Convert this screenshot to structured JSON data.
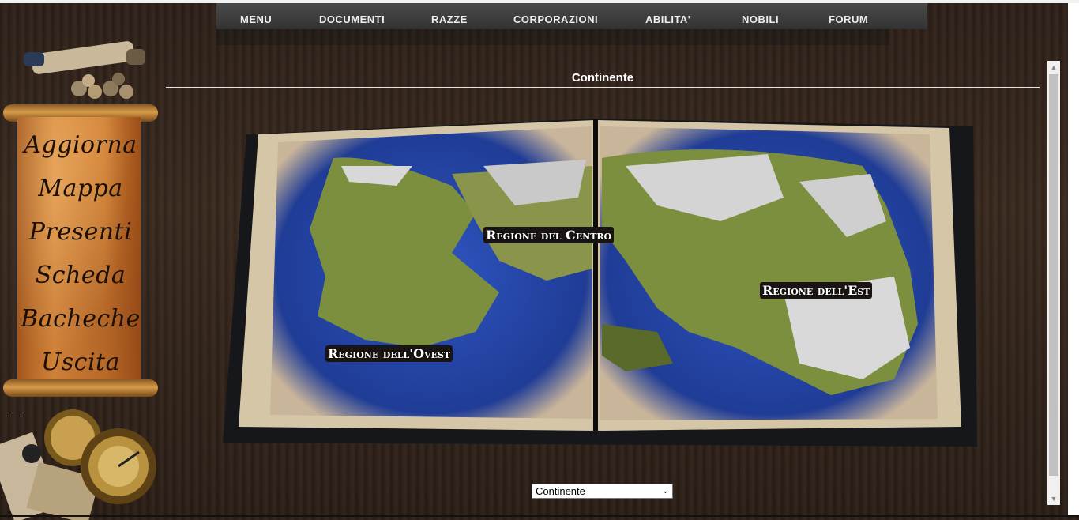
{
  "nav": {
    "items": [
      "MENU",
      "DOCUMENTI",
      "RAZZE",
      "CORPORAZIONI",
      "ABILITA'",
      "NOBILI",
      "FORUM"
    ]
  },
  "sidebar": {
    "links": [
      "Aggiorna",
      "Mappa",
      "Presenti",
      "Scheda",
      "Bacheche",
      "Uscita"
    ]
  },
  "main": {
    "title": "Continente",
    "regions": [
      "Regione del Centro",
      "Regione dell'Est",
      "Regione dell'Ovest"
    ],
    "select": {
      "selected": "Continente"
    }
  },
  "colors": {
    "background": "#2e2119",
    "nav_bg": "#3d3d3d",
    "scroll_paper": "#d28236",
    "sea": "#2747a8",
    "land": "#7c8f3e",
    "label_bg": "#1a1512"
  },
  "icons": [
    "scroll-deco-icon",
    "compass-icon",
    "chevron-down-icon"
  ]
}
